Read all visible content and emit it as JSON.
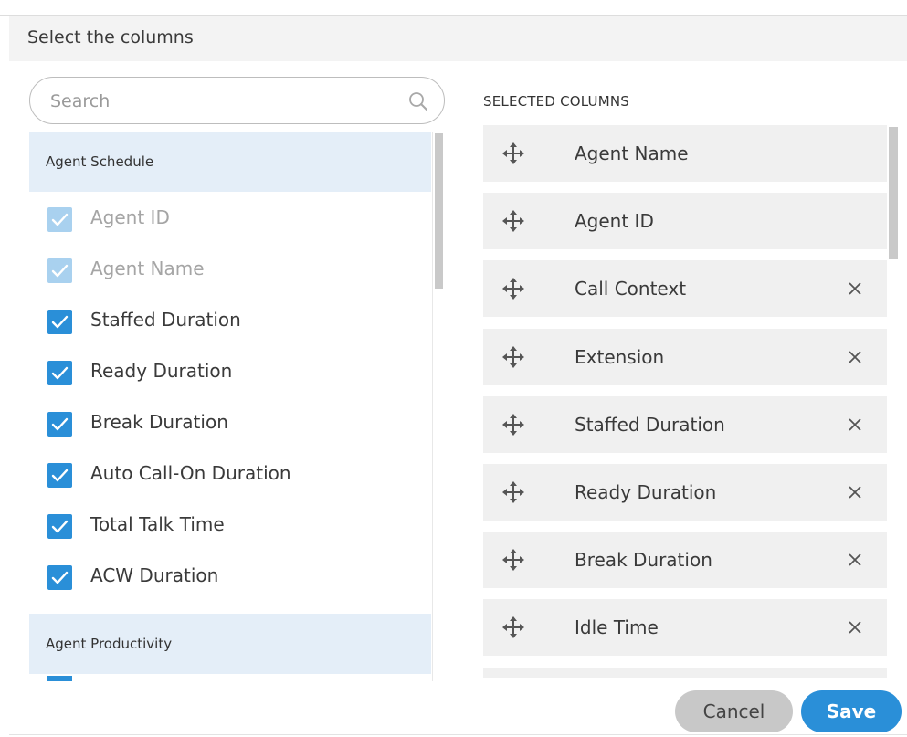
{
  "dialog": {
    "title": "Select the columns"
  },
  "search": {
    "placeholder": "Search"
  },
  "available": {
    "groups": [
      {
        "name": "Agent Schedule",
        "items": [
          {
            "label": "Agent ID",
            "checked": true,
            "disabled": true
          },
          {
            "label": "Agent Name",
            "checked": true,
            "disabled": true
          },
          {
            "label": "Staffed Duration",
            "checked": true,
            "disabled": false
          },
          {
            "label": "Ready Duration",
            "checked": true,
            "disabled": false
          },
          {
            "label": "Break Duration",
            "checked": true,
            "disabled": false
          },
          {
            "label": "Auto Call-On Duration",
            "checked": true,
            "disabled": false
          },
          {
            "label": "Total Talk Time",
            "checked": true,
            "disabled": false
          },
          {
            "label": "ACW Duration",
            "checked": true,
            "disabled": false
          }
        ]
      },
      {
        "name": "Agent Productivity",
        "items": []
      }
    ]
  },
  "selected": {
    "title": "SELECTED COLUMNS",
    "items": [
      {
        "label": "Agent Name",
        "removable": false
      },
      {
        "label": "Agent ID",
        "removable": false
      },
      {
        "label": "Call Context",
        "removable": true
      },
      {
        "label": "Extension",
        "removable": true
      },
      {
        "label": "Staffed Duration",
        "removable": true
      },
      {
        "label": "Ready Duration",
        "removable": true
      },
      {
        "label": "Break Duration",
        "removable": true
      },
      {
        "label": "Idle Time",
        "removable": true
      }
    ]
  },
  "actions": {
    "cancel_label": "Cancel",
    "save_label": "Save"
  },
  "colors": {
    "accent": "#2a8fd8",
    "group_header_bg": "#e4eef8",
    "selected_row_bg": "#f0f0f0"
  },
  "icons": {
    "search": "search-icon",
    "move": "move-icon",
    "remove": "close-icon",
    "check": "checkmark-icon"
  }
}
